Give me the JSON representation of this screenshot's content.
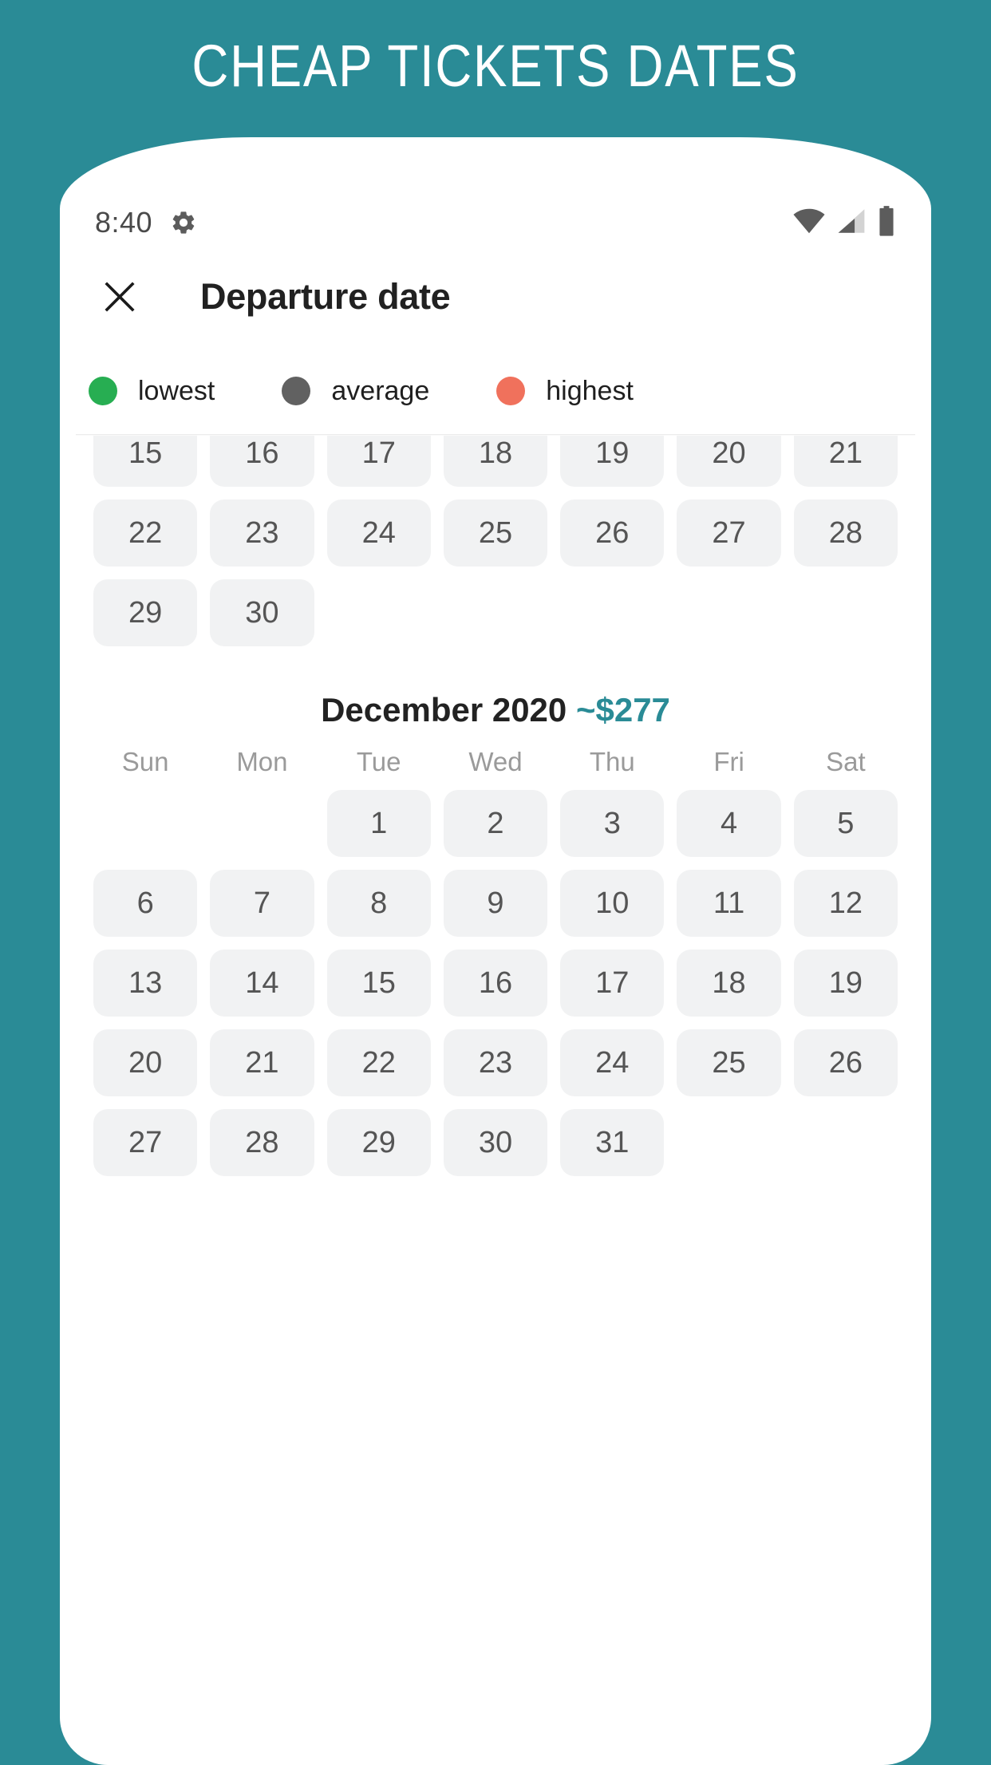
{
  "promo": {
    "title": "CHEAP TICKETS DATES",
    "background_color": "#2a8b96"
  },
  "statusbar": {
    "time": "8:40",
    "icons": [
      "gear-icon",
      "wifi-icon",
      "cellular-signal-icon",
      "battery-icon"
    ]
  },
  "appbar": {
    "close_label": "✕",
    "title": "Departure date"
  },
  "legend": {
    "items": [
      {
        "label": "lowest",
        "color": "#27ae52"
      },
      {
        "label": "average",
        "color": "#616161"
      },
      {
        "label": "highest",
        "color": "#f0715c"
      }
    ]
  },
  "calendar": {
    "weekdays": [
      "Sun",
      "Mon",
      "Tue",
      "Wed",
      "Thu",
      "Fri",
      "Sat"
    ],
    "months": [
      {
        "title": "",
        "price": "",
        "partial": true,
        "leading_blanks": 0,
        "weeks": [
          [
            "15",
            "16",
            "17",
            "18",
            "19",
            "20",
            "21"
          ],
          [
            "22",
            "23",
            "24",
            "25",
            "26",
            "27",
            "28"
          ],
          [
            "29",
            "30",
            "",
            "",
            "",
            "",
            ""
          ]
        ]
      },
      {
        "title": "December 2020",
        "price": "~$277",
        "partial": false,
        "leading_blanks": 2,
        "weeks": [
          [
            "",
            "",
            "1",
            "2",
            "3",
            "4",
            "5"
          ],
          [
            "6",
            "7",
            "8",
            "9",
            "10",
            "11",
            "12"
          ],
          [
            "13",
            "14",
            "15",
            "16",
            "17",
            "18",
            "19"
          ],
          [
            "20",
            "21",
            "22",
            "23",
            "24",
            "25",
            "26"
          ],
          [
            "27",
            "28",
            "29",
            "30",
            "31",
            "",
            ""
          ]
        ]
      }
    ]
  },
  "theme": {
    "teal": "#2a8b96",
    "day_cell_bg": "#f1f2f3",
    "day_text": "#555555",
    "weekday_text": "#9a9a9a"
  }
}
